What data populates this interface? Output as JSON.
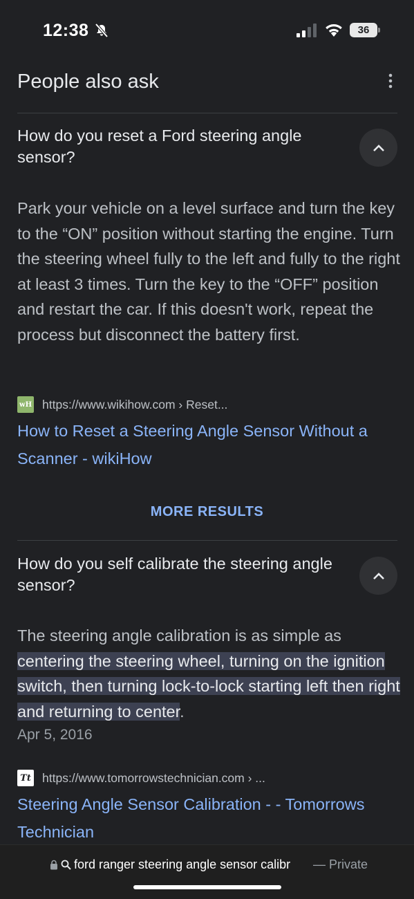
{
  "status_bar": {
    "time": "12:38",
    "battery": "36"
  },
  "people_also_ask": {
    "title": "People also ask",
    "more_results_label": "MORE RESULTS",
    "items": [
      {
        "question": "How do you reset a Ford steering angle sensor?",
        "answer": "Park your vehicle on a level surface and turn the key to the “ON” position without starting the engine. Turn the steering wheel fully to the left and fully to the right at least 3 times. Turn the key to the “OFF” position and restart the car. If this doesn't work, repeat the process but disconnect the battery first.",
        "source_url": "https://www.wikihow.com › Reset...",
        "favicon_text": "wH",
        "link_title": "How to Reset a Steering Angle Sensor Without a Scanner - wikiHow"
      },
      {
        "question": "How do you self calibrate the steering angle sensor?",
        "answer_plain": "The steering angle calibration is as simple as ",
        "answer_highlight": "centering the steering wheel, turning on the ignition switch, then turning lock-to-lock starting left then right and returning to center",
        "answer_end": ".",
        "date": "Apr 5, 2016",
        "source_url": "https://www.tomorrowstechnician.com › ...",
        "favicon_text": "Tt",
        "link_title": "Steering Angle Sensor Calibration - - Tomorrows Technician"
      }
    ]
  },
  "address_bar": {
    "query": "ford ranger steering angle sensor calibr",
    "private_label": "— Private"
  },
  "colors": {
    "background": "#202124",
    "link": "#8ab4f8",
    "highlight": "#3d4152"
  }
}
